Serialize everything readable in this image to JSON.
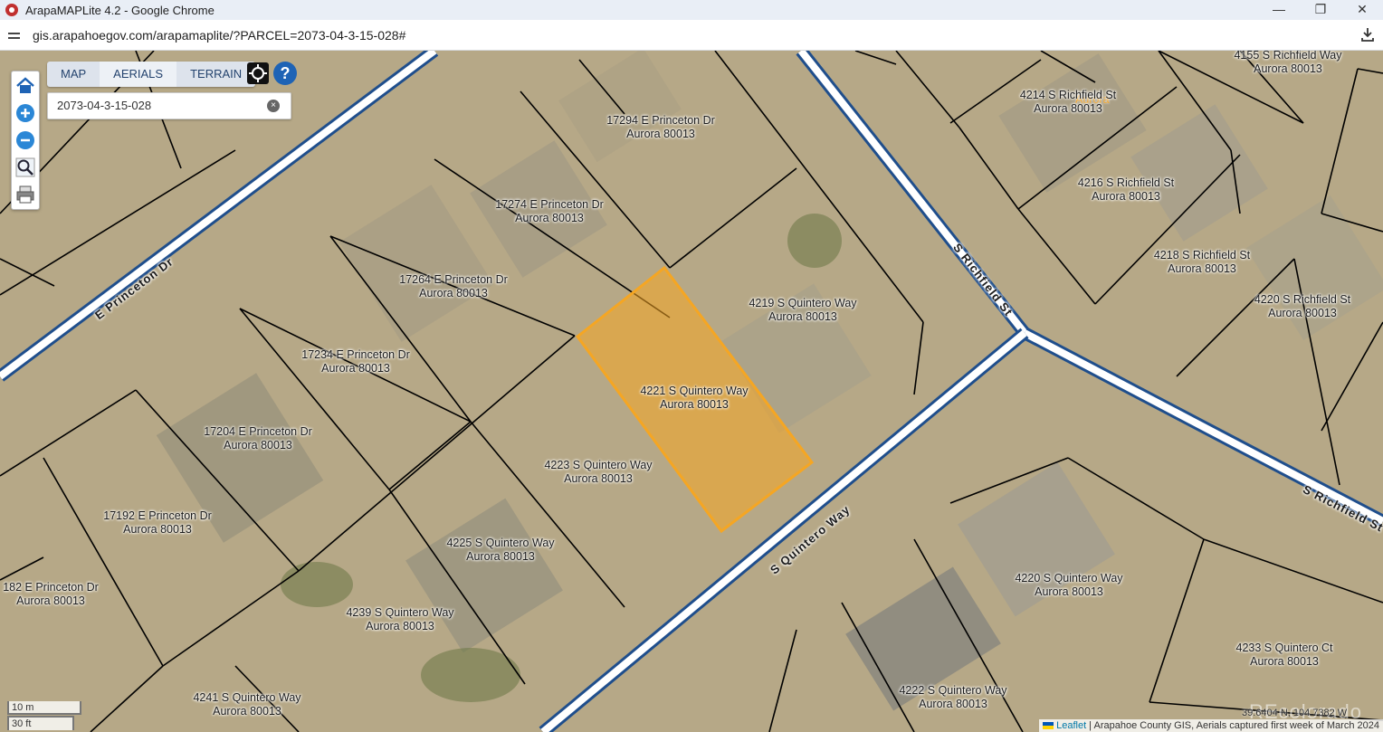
{
  "window": {
    "title": "ArapaMAPLite 4.2 - Google Chrome",
    "minimize": "—",
    "restore": "❐",
    "close": "✕"
  },
  "browser": {
    "url": "gis.arapahoegov.com/arapamaplite/?PARCEL=2073-04-3-15-028#"
  },
  "map": {
    "tabs": [
      {
        "label": "MAP",
        "active": false
      },
      {
        "label": "AERIALS",
        "active": true
      },
      {
        "label": "TERRAIN",
        "active": false
      }
    ],
    "help_label": "?",
    "search": {
      "value": "2073-04-3-15-028",
      "clear_label": "×"
    },
    "toolbar": [
      "home-icon",
      "zoom-in-icon",
      "zoom-out-icon",
      "zoom-box-icon",
      "print-icon"
    ],
    "colors": {
      "selected_parcel": "#f5a623",
      "street_line": "#1f4e8c",
      "parcel_line": "#000000"
    },
    "streets": [
      "E Princeton Dr",
      "S Richfield St",
      "S Richfield St",
      "S Quintero Way"
    ],
    "city_label": "Aurora",
    "parcels": [
      {
        "line1": "17294 E Princeton Dr",
        "line2": "Aurora 80013"
      },
      {
        "line1": "17274 E Princeton Dr",
        "line2": "Aurora 80013"
      },
      {
        "line1": "17264 E Princeton Dr",
        "line2": "Aurora 80013"
      },
      {
        "line1": "17234 E Princeton Dr",
        "line2": "Aurora 80013"
      },
      {
        "line1": "17204 E Princeton Dr",
        "line2": "Aurora 80013"
      },
      {
        "line1": "17192 E Princeton Dr",
        "line2": "Aurora 80013"
      },
      {
        "line1": "182 E Princeton Dr",
        "line2": "Aurora 80013"
      },
      {
        "line1": "4219 S Quintero Way",
        "line2": "Aurora 80013"
      },
      {
        "line1": "4221 S Quintero Way",
        "line2": "Aurora 80013"
      },
      {
        "line1": "4223 S Quintero Way",
        "line2": "Aurora 80013"
      },
      {
        "line1": "4225 S Quintero Way",
        "line2": "Aurora 80013"
      },
      {
        "line1": "4239 S Quintero Way",
        "line2": "Aurora 80013"
      },
      {
        "line1": "4241 S Quintero Way",
        "line2": "Aurora 80013"
      },
      {
        "line1": "4214 S Richfield St",
        "line2": "Aurora 80013"
      },
      {
        "line1": "4216 S Richfield St",
        "line2": "Aurora 80013"
      },
      {
        "line1": "4218 S Richfield St",
        "line2": "Aurora 80013"
      },
      {
        "line1": "4220 S Richfield St",
        "line2": "Aurora 80013"
      },
      {
        "line1": "4155 S Richfield Way",
        "line2": "Aurora 80013"
      },
      {
        "line1": "4220 S Quintero Way",
        "line2": "Aurora 80013"
      },
      {
        "line1": "4222 S Quintero Way",
        "line2": "Aurora 80013"
      },
      {
        "line1": "4233 S Quintero Ct",
        "line2": "Aurora 80013"
      }
    ],
    "scale": {
      "metric": "10 m",
      "imperial": "30 ft"
    },
    "coordinates": "39.6404 N, 104.7382 W",
    "attribution": {
      "leaflet": "Leaflet",
      "text": " | Arapahoe County GIS, Aerials captured first week of March 2024"
    }
  }
}
